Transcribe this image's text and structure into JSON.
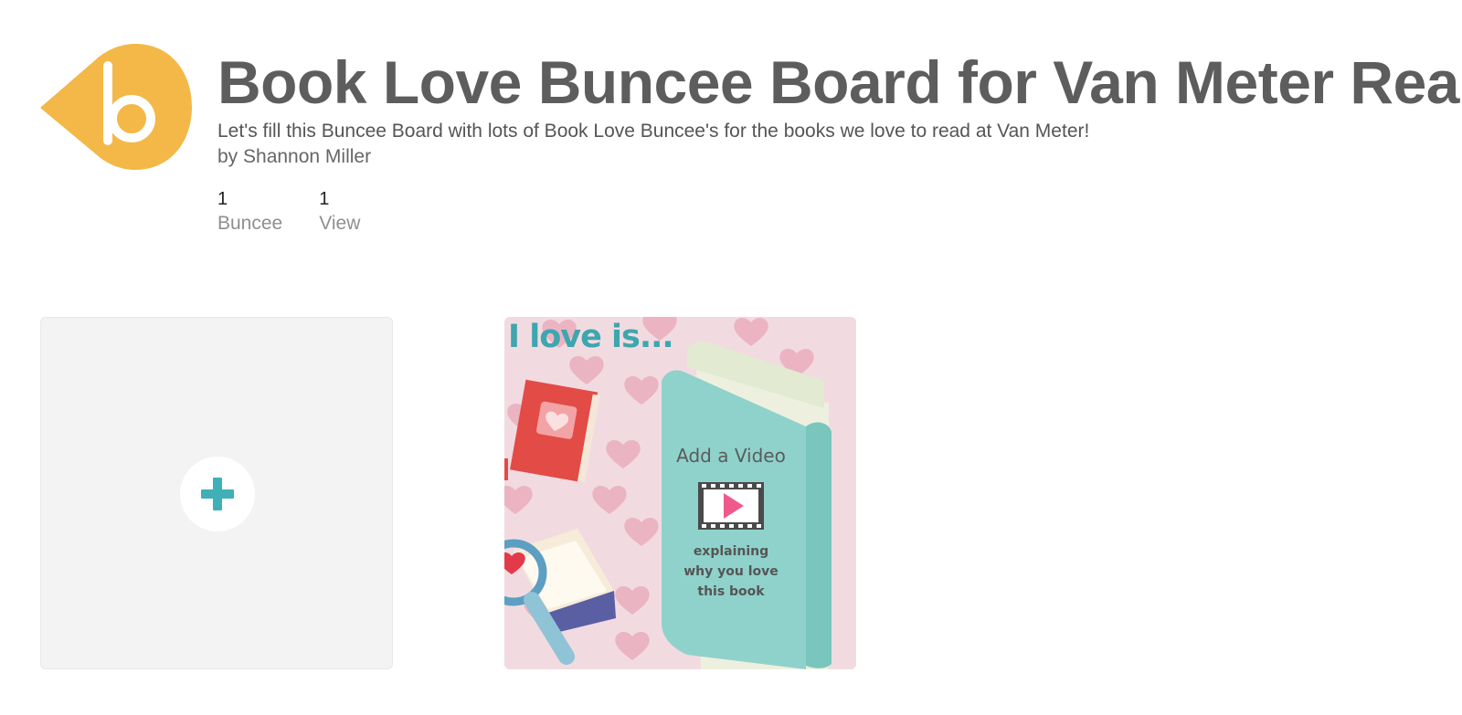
{
  "board": {
    "title": "Book Love Buncee Board for Van Meter Rea",
    "description": "Let's fill this Buncee Board with lots of Book Love Buncee's for the books we love to read at Van Meter!",
    "author": "by Shannon Miller",
    "brand_color": "#f3b847",
    "accent_color": "#3fb0b8"
  },
  "stats": [
    {
      "count": "1",
      "label": "Buncee"
    },
    {
      "count": "1",
      "label": "View"
    }
  ],
  "add_card": {
    "icon": "plus-icon"
  },
  "buncee_card": {
    "heading": "I love is...",
    "video_title": "Add a Video",
    "caption_line1": "explaining",
    "caption_line2": "why you love",
    "caption_line3": "this book",
    "icon": "video-play-icon"
  }
}
